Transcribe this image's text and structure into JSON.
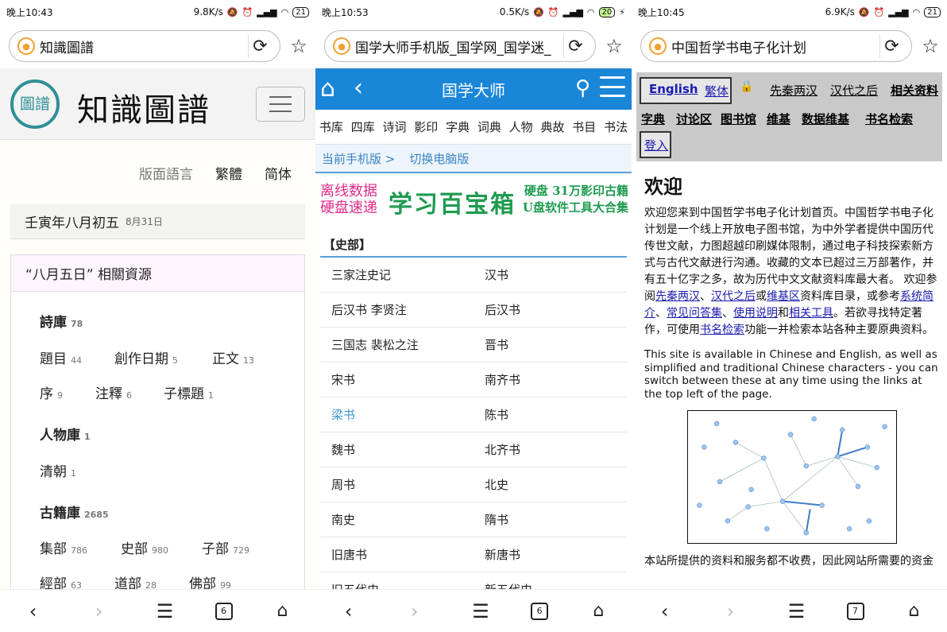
{
  "phones": [
    {
      "status": {
        "time": "晚上10:43",
        "speed": "9.8K/s",
        "battery": "21"
      },
      "address": {
        "title": "知識圖譜"
      },
      "site": {
        "seal_text": "圖譜",
        "title": "知識圖譜",
        "lang_label": "版面語言",
        "lang_trad": "繁體",
        "lang_simp": "简体",
        "date": "壬寅年八月初五",
        "date_small": "8月31日",
        "resource_title": "“八月五日” 相關資源",
        "categories": [
          {
            "name": "詩庫",
            "count": "78"
          },
          {
            "name": "人物庫",
            "count": "1"
          },
          {
            "name": "古籍庫",
            "count": "2685"
          }
        ],
        "subs": [
          {
            "name": "題目",
            "count": "44"
          },
          {
            "name": "創作日期",
            "count": "5"
          },
          {
            "name": "正文",
            "count": "13"
          },
          {
            "name": "序",
            "count": "9"
          },
          {
            "name": "注釋",
            "count": "6"
          },
          {
            "name": "子標題",
            "count": "1"
          },
          {
            "name": "清朝",
            "count": "1"
          },
          {
            "name": "集部",
            "count": "786"
          },
          {
            "name": "史部",
            "count": "980"
          },
          {
            "name": "子部",
            "count": "729"
          },
          {
            "name": "經部",
            "count": "63"
          },
          {
            "name": "道部",
            "count": "28"
          },
          {
            "name": "佛部",
            "count": "99"
          }
        ]
      },
      "tabs_count": "6"
    },
    {
      "status": {
        "time": "晚上10:53",
        "speed": "0.5K/s",
        "battery": "20"
      },
      "address": {
        "title": "国学大师手机版_国学网_国学迷_"
      },
      "site": {
        "title": "国学大师",
        "menu": [
          "书库",
          "四库",
          "诗词",
          "影印",
          "字典",
          "词典",
          "人物",
          "典故",
          "书目",
          "书法"
        ],
        "link_mobile": "当前手机版 >",
        "link_pc": "切换电脑版",
        "banner_left_1": "离线数据",
        "banner_left_2": "硬盘速递",
        "banner_main": "学习百宝箱",
        "banner_right_1": "硬盘 31万影印古籍",
        "banner_right_2": "U盘软件工具大合集",
        "section": "【史部】",
        "books": [
          [
            "三家注史记",
            "汉书"
          ],
          [
            "后汉书 李贤注",
            "后汉书"
          ],
          [
            "三国志 裴松之注",
            "晋书"
          ],
          [
            "宋书",
            "南齐书"
          ],
          [
            "梁书",
            "陈书"
          ],
          [
            "魏书",
            "北齐书"
          ],
          [
            "周书",
            "北史"
          ],
          [
            "南史",
            "隋书"
          ],
          [
            "旧唐书",
            "新唐书"
          ],
          [
            "旧五代史",
            "新五代史"
          ]
        ]
      },
      "tabs_count": "6"
    },
    {
      "status": {
        "time": "晚上10:45",
        "speed": "6.9K/s",
        "battery": "21"
      },
      "address": {
        "title": "中国哲学书电子化计划"
      },
      "site": {
        "nav_english": "English",
        "nav_trad": "繁体",
        "nav_items": [
          "先秦两汉",
          "汉代之后",
          "相关资料",
          "字典",
          "讨论区",
          "图书馆",
          "维基",
          "数据维基",
          "书名检索"
        ],
        "login": "登入",
        "heading": "欢迎",
        "p1_a": "欢迎您来到中国哲学书电子化计划首页。中国哲学书电子化计划是一个线上开放电子图书馆，为中外学者提供中国历代传世文献，力图超越印刷媒体限制，通过电子科技探索新方式与古代文献进行沟通。收藏的文本已超过三万部著作，并有五十亿字之多，故为历代中文文献资料库最大者。 欢迎参阅",
        "p1_l1": "先秦两汉",
        "p1_s1": "、",
        "p1_l2": "汉代之后",
        "p1_s2": "或",
        "p1_l3": "维基区",
        "p1_s3": "资料库目录，或参考",
        "p1_l4": "系统简介",
        "p1_s4": "、",
        "p1_l5": "常见问答集",
        "p1_s5": "、",
        "p1_l6": "使用说明",
        "p1_s6": "和",
        "p1_l7": "相关工具",
        "p1_s7": "。若欲寻找特定著作，可使用",
        "p1_l8": "书名检索",
        "p1_s8": "功能一并检索本站各种主要原典资料。",
        "p2": "This site is available in Chinese and English, as well as simplified and traditional Chinese characters - you can switch between these at any time using the links at the top left of the page.",
        "p3": "本站所提供的资料和服务都不收费，因此网站所需要的资金"
      },
      "tabs_count": "7"
    }
  ]
}
